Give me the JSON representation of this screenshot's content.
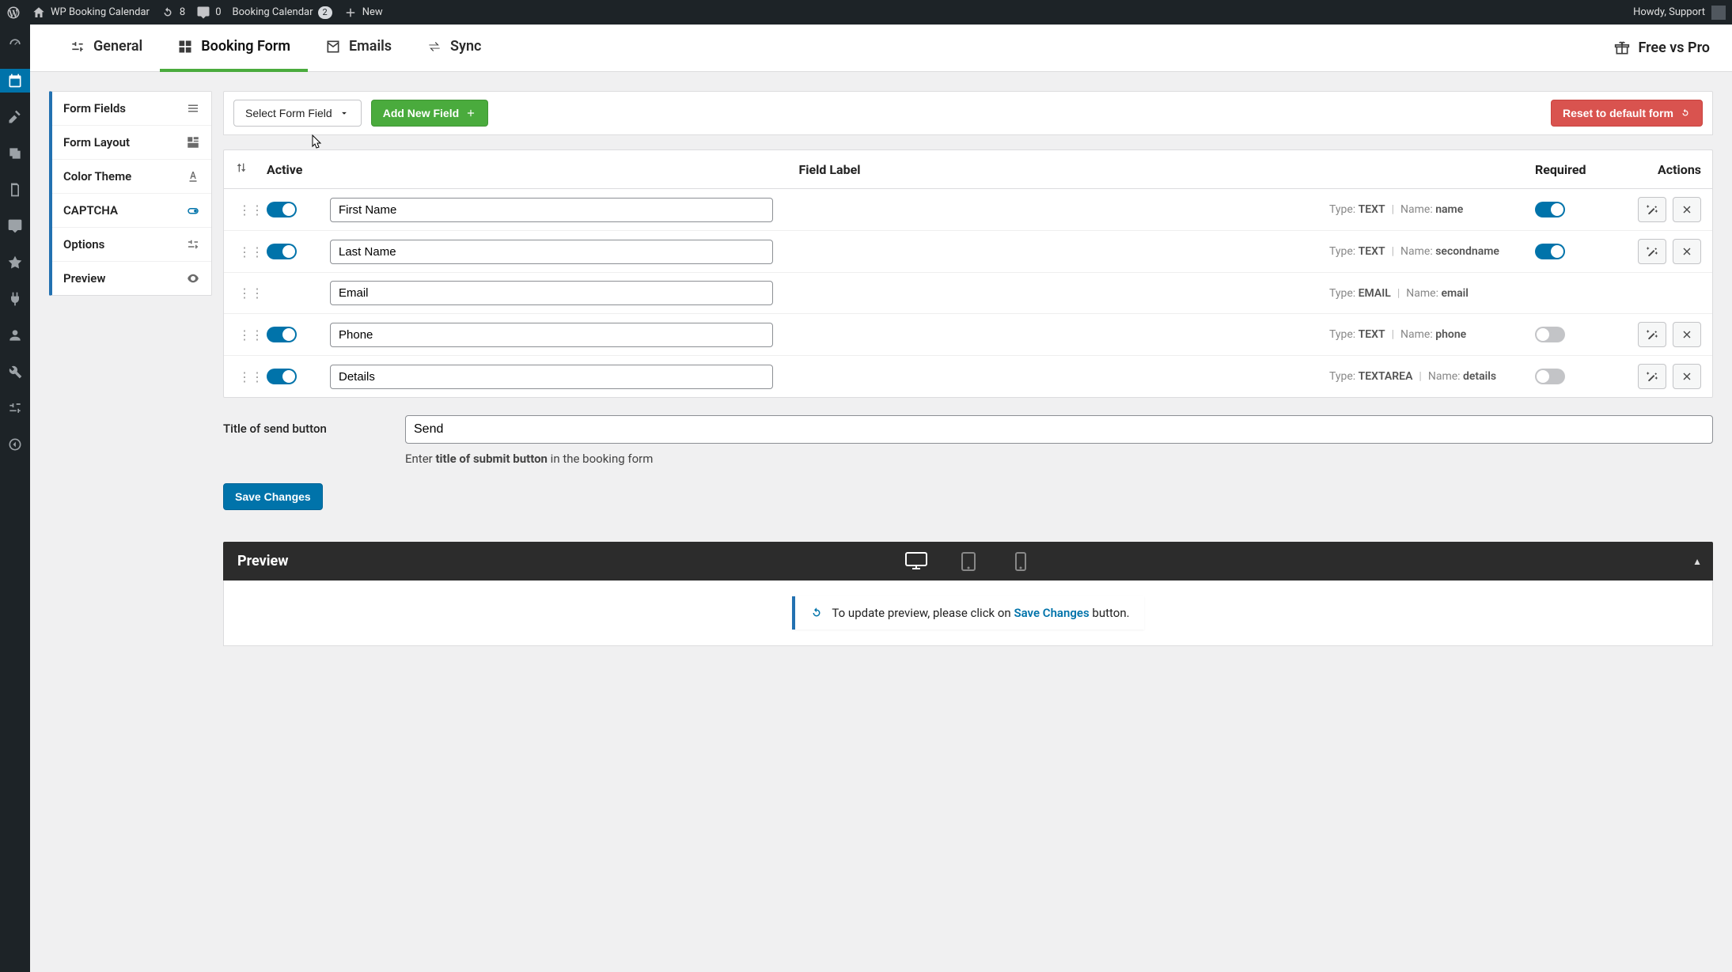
{
  "adminbar": {
    "site_title": "WP Booking Calendar",
    "updates_count": "8",
    "comments_count": "0",
    "calendar_label": "Booking Calendar",
    "calendar_badge": "2",
    "new_label": "New",
    "howdy": "Howdy, Support"
  },
  "tabs": {
    "general": "General",
    "booking_form": "Booking Form",
    "emails": "Emails",
    "sync": "Sync",
    "free_vs_pro": "Free vs Pro"
  },
  "sidenav": {
    "form_fields": "Form Fields",
    "form_layout": "Form Layout",
    "color_theme": "Color Theme",
    "captcha": "CAPTCHA",
    "options": "Options",
    "preview": "Preview"
  },
  "actions": {
    "select_form_field": "Select Form Field",
    "add_new_field": "Add New Field",
    "reset_default": "Reset to default form",
    "save_changes": "Save Changes"
  },
  "thead": {
    "active": "Active",
    "field_label": "Field Label",
    "required": "Required",
    "actions": "Actions"
  },
  "meta_labels": {
    "type": "Type:",
    "name": "Name:"
  },
  "fields": [
    {
      "label": "First Name",
      "type": "TEXT",
      "name": "name",
      "active": true,
      "required": true,
      "show_toggles": true,
      "show_actions": true
    },
    {
      "label": "Last Name",
      "type": "TEXT",
      "name": "secondname",
      "active": true,
      "required": true,
      "show_toggles": true,
      "show_actions": true
    },
    {
      "label": "Email",
      "type": "EMAIL",
      "name": "email",
      "active": true,
      "required": true,
      "show_toggles": false,
      "show_actions": false
    },
    {
      "label": "Phone",
      "type": "TEXT",
      "name": "phone",
      "active": true,
      "required": false,
      "show_toggles": true,
      "show_actions": true
    },
    {
      "label": "Details",
      "type": "TEXTAREA",
      "name": "details",
      "active": true,
      "required": false,
      "show_toggles": true,
      "show_actions": true
    }
  ],
  "send_button": {
    "label": "Title of send button",
    "value": "Send",
    "hint_prefix": "Enter ",
    "hint_strong": "title of submit button",
    "hint_suffix": " in the booking form"
  },
  "preview": {
    "title": "Preview",
    "notice_prefix": "To update preview, please click on ",
    "notice_link": "Save Changes",
    "notice_suffix": " button."
  }
}
